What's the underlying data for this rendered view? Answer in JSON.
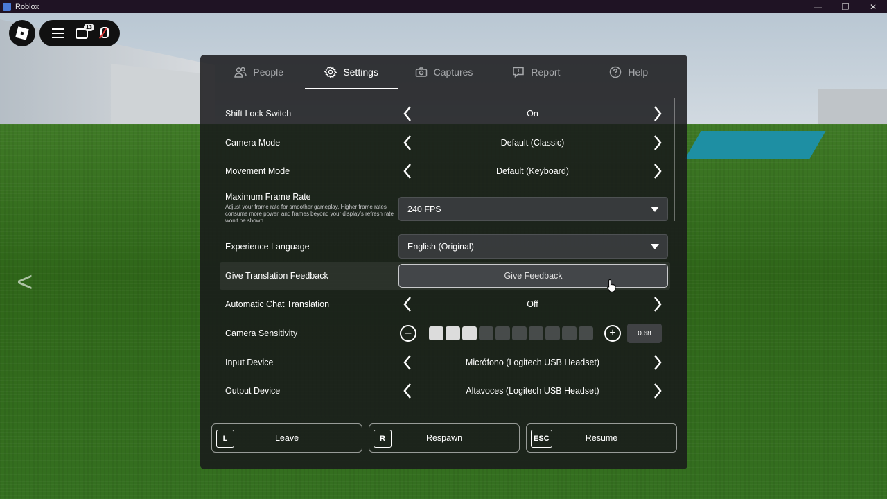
{
  "window": {
    "title": "Roblox",
    "controls": [
      "minimize",
      "restore",
      "close"
    ]
  },
  "hud": {
    "chat_badge": "13"
  },
  "world": {
    "side_arrow": "<"
  },
  "tabs": [
    {
      "label": "People",
      "icon": "people-icon"
    },
    {
      "label": "Settings",
      "icon": "gear-icon",
      "active": true
    },
    {
      "label": "Captures",
      "icon": "camera-icon"
    },
    {
      "label": "Report",
      "icon": "report-icon"
    },
    {
      "label": "Help",
      "icon": "help-icon"
    }
  ],
  "settings": {
    "shift_lock": {
      "label": "Shift Lock Switch",
      "value": "On"
    },
    "camera_mode": {
      "label": "Camera Mode",
      "value": "Default (Classic)"
    },
    "movement_mode": {
      "label": "Movement Mode",
      "value": "Default (Keyboard)"
    },
    "frame_rate": {
      "label": "Maximum Frame Rate",
      "description": "Adjust your frame rate for smoother gameplay. Higher frame rates consume more power, and frames beyond your display's refresh rate won't be shown.",
      "value": "240 FPS"
    },
    "language": {
      "label": "Experience Language",
      "value": "English (Original)"
    },
    "translation_feedback": {
      "label": "Give Translation Feedback",
      "button": "Give Feedback"
    },
    "auto_chat_translation": {
      "label": "Automatic Chat Translation",
      "value": "Off"
    },
    "camera_sensitivity": {
      "label": "Camera Sensitivity",
      "value": "0.68",
      "filled_segments": 3,
      "total_segments": 10
    },
    "input_device": {
      "label": "Input Device",
      "value": "Micrófono (Logitech USB Headset)"
    },
    "output_device": {
      "label": "Output Device",
      "value": "Altavoces (Logitech USB Headset)"
    }
  },
  "actions": {
    "leave": {
      "key": "L",
      "label": "Leave"
    },
    "respawn": {
      "key": "R",
      "label": "Respawn"
    },
    "resume": {
      "key": "ESC",
      "label": "Resume"
    }
  },
  "colors": {
    "panel_bg": "#18191b",
    "titlebar_bg": "#1f1324",
    "mic_muted": "#e03a3a"
  }
}
